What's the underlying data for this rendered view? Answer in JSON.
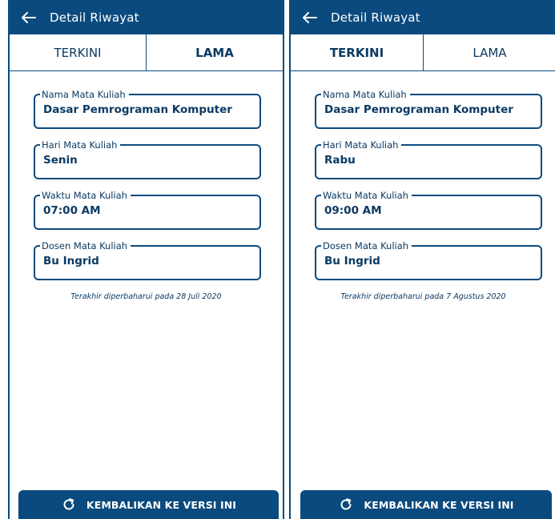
{
  "colors": {
    "primary": "#0b4a7e",
    "text": "#0b3a63",
    "background": "#ffffff"
  },
  "screens": [
    {
      "appbar": {
        "back_icon": "arrow-left-icon",
        "title": "Detail Riwayat"
      },
      "tabs": [
        {
          "label": "TERKINI",
          "active": false
        },
        {
          "label": "LAMA",
          "active": true
        }
      ],
      "fields": [
        {
          "label": "Nama Mata Kuliah",
          "value": "Dasar Pemrograman Komputer"
        },
        {
          "label": "Hari Mata Kuliah",
          "value": "Senin"
        },
        {
          "label": "Waktu Mata Kuliah",
          "value": "07:00 AM"
        },
        {
          "label": "Dosen Mata Kuliah",
          "value": "Bu Ingrid"
        }
      ],
      "updated_note": "Terakhir diperbaharui pada 28 Juli 2020",
      "restore_button": {
        "icon": "refresh-icon",
        "label": "KEMBALIKAN KE VERSI INI"
      }
    },
    {
      "appbar": {
        "back_icon": "arrow-left-icon",
        "title": "Detail Riwayat"
      },
      "tabs": [
        {
          "label": "TERKINI",
          "active": true
        },
        {
          "label": "LAMA",
          "active": false
        }
      ],
      "fields": [
        {
          "label": "Nama Mata Kuliah",
          "value": "Dasar Pemrograman Komputer"
        },
        {
          "label": "Hari Mata Kuliah",
          "value": "Rabu"
        },
        {
          "label": "Waktu Mata Kuliah",
          "value": "09:00 AM"
        },
        {
          "label": "Dosen Mata Kuliah",
          "value": "Bu Ingrid"
        }
      ],
      "updated_note": "Terakhir diperbaharui pada 7 Agustus 2020",
      "restore_button": {
        "icon": "refresh-icon",
        "label": "KEMBALIKAN KE VERSI INI"
      }
    }
  ]
}
